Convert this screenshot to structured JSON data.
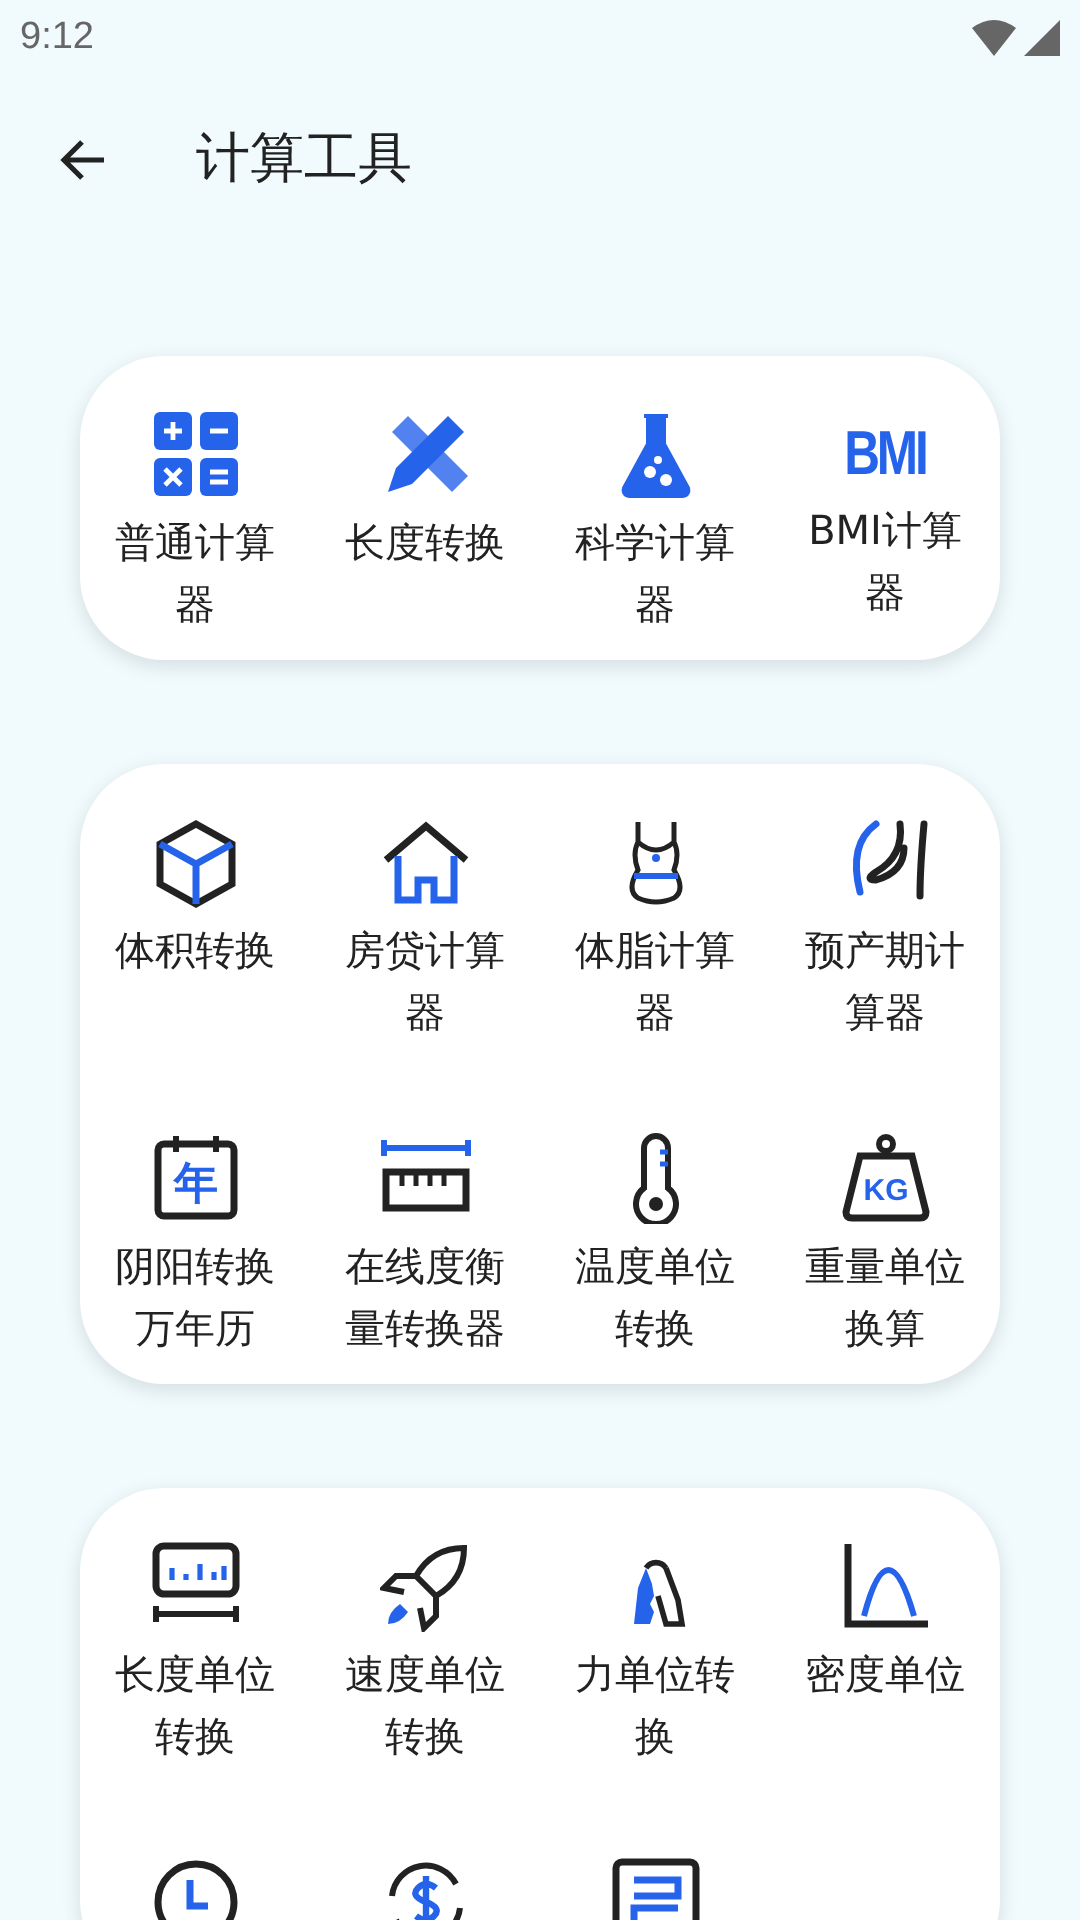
{
  "status_bar": {
    "time": "9:12"
  },
  "app_bar": {
    "title": "计算工具"
  },
  "groups": [
    {
      "tools": [
        {
          "kind": "calculator",
          "label": "普通计算器"
        },
        {
          "kind": "pencil-ruler",
          "label": "长度转换"
        },
        {
          "kind": "flask",
          "label": "科学计算器"
        },
        {
          "kind": "bmi",
          "icon_text": "BMI",
          "label": "BMI计算器"
        }
      ]
    },
    {
      "tools": [
        {
          "kind": "cube",
          "label": "体积转换"
        },
        {
          "kind": "house",
          "label": "房贷计算器"
        },
        {
          "kind": "swimsuit",
          "label": "体脂计算器"
        },
        {
          "kind": "belly",
          "label": "预产期计算器"
        },
        {
          "kind": "calendar",
          "icon_text": "年",
          "label": "阴阳转换万年历"
        },
        {
          "kind": "ruler",
          "label": "在线度衡量转换器"
        },
        {
          "kind": "thermometer",
          "label": "温度单位转换"
        },
        {
          "kind": "weight",
          "icon_text": "KG",
          "label": "重量单位换算"
        }
      ]
    },
    {
      "tools": [
        {
          "kind": "meter",
          "label": "长度单位转换"
        },
        {
          "kind": "rocket",
          "label": "速度单位转换"
        },
        {
          "kind": "grip",
          "label": "力单位转换"
        },
        {
          "kind": "curve",
          "label": "密度单位"
        },
        {
          "kind": "clock"
        },
        {
          "kind": "dollar"
        },
        {
          "kind": "frame"
        }
      ]
    }
  ]
}
